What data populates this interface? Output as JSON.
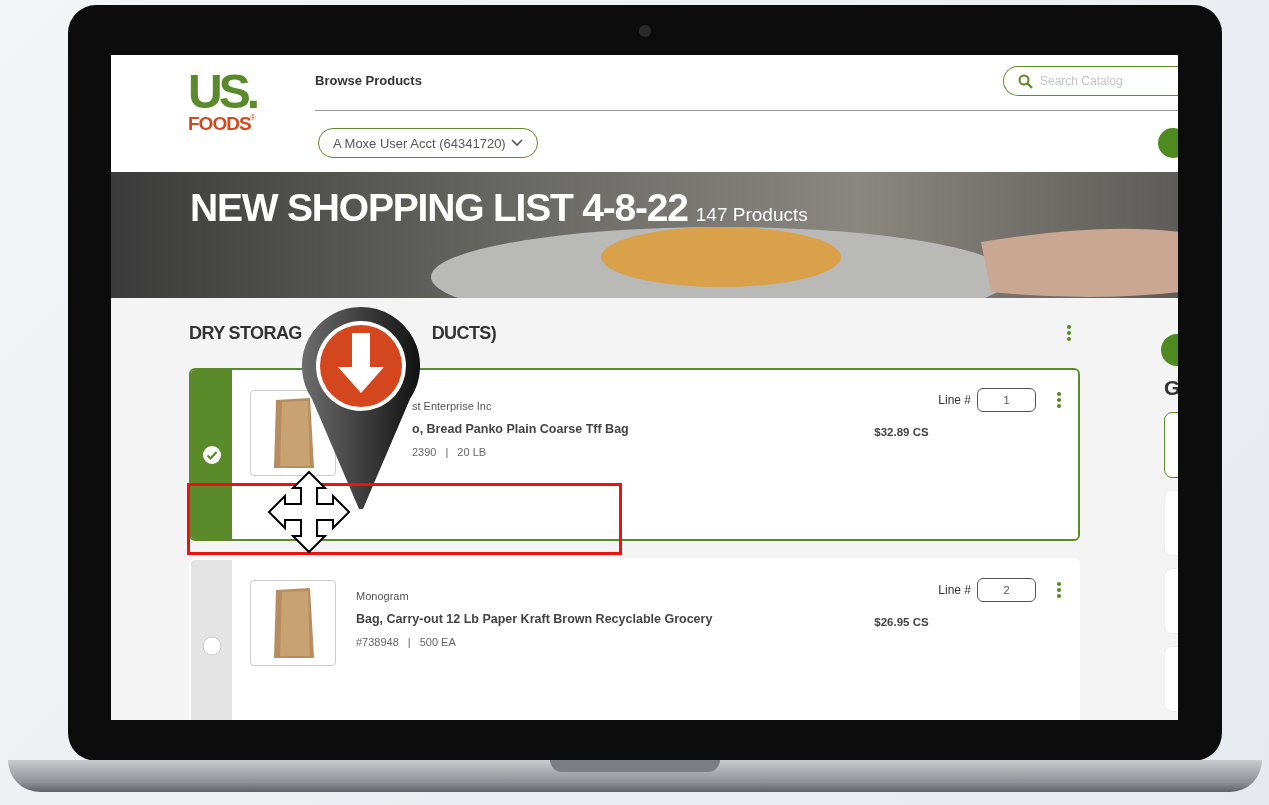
{
  "header": {
    "logo_top": "US.",
    "logo_bottom": "FOODS",
    "logo_mark": "®",
    "nav_link": "Browse Products",
    "search": {
      "placeholder": "Search Catalog"
    },
    "account_selector": "A Moxe User Acct (64341720)"
  },
  "banner": {
    "title": "NEW SHOPPING LIST 4-8-22",
    "count": "147 Products"
  },
  "section": {
    "title_start": "DRY STORAG",
    "title_end": "DUCTS)"
  },
  "items": [
    {
      "selected": true,
      "occluded": true,
      "brand": "st Enterprise Inc",
      "name": "o, Bread Panko Plain Coarse Tff Bag",
      "sku": "2390",
      "separator": "|",
      "pack": "20 LB",
      "line_label": "Line #",
      "line_number": "1",
      "price": "$32.89 CS"
    },
    {
      "selected": false,
      "occluded": false,
      "brand": "Monogram",
      "name": "Bag, Carry-out 12 Lb Paper Kraft Brown Recyclable Grocery",
      "sku": "#738948",
      "separator": "|",
      "pack": "500 EA",
      "line_label": "Line #",
      "line_number": "2",
      "price": "$26.95 CS"
    }
  ],
  "side_panel": {
    "heading": "G"
  }
}
